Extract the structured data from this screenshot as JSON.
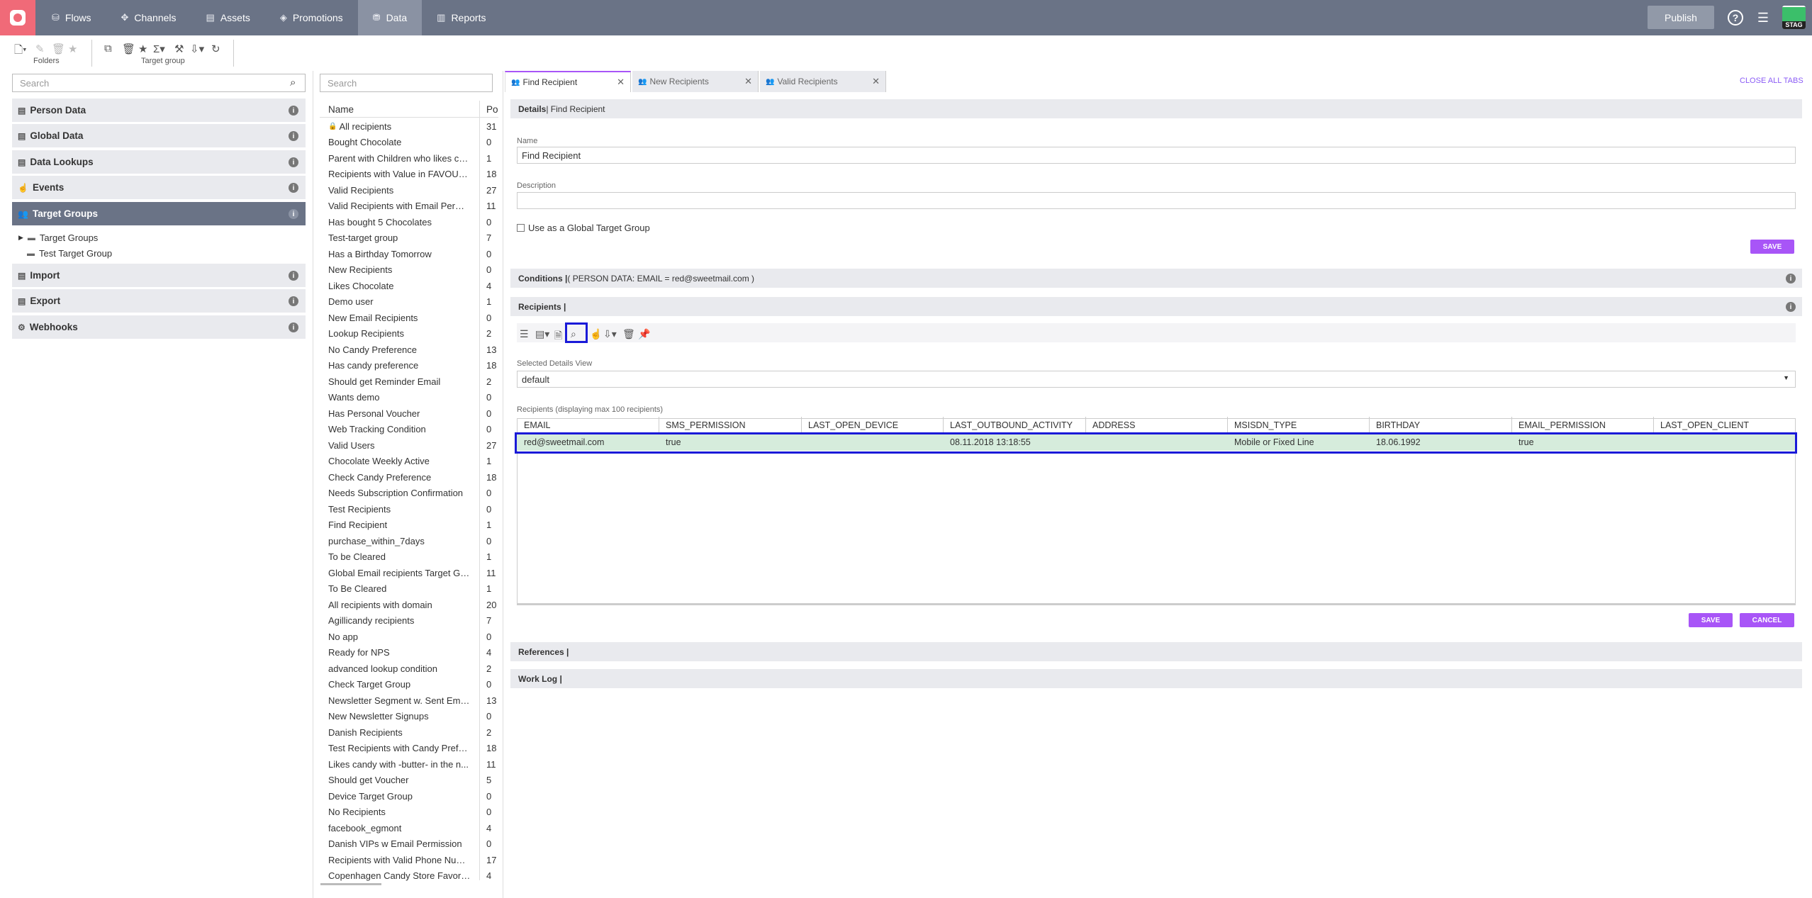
{
  "topnav": {
    "items": [
      {
        "label": "Flows",
        "icon": "flows-icon"
      },
      {
        "label": "Channels",
        "icon": "channels-icon"
      },
      {
        "label": "Assets",
        "icon": "assets-icon"
      },
      {
        "label": "Promotions",
        "icon": "promotions-icon"
      },
      {
        "label": "Data",
        "icon": "data-icon",
        "active": true
      },
      {
        "label": "Reports",
        "icon": "reports-icon"
      }
    ],
    "publish": "Publish",
    "env_badge": "STAG"
  },
  "toolbar": {
    "folders_label": "Folders",
    "target_group_label": "Target group"
  },
  "left_search": {
    "placeholder": "Search"
  },
  "left_panel": {
    "items": [
      {
        "label": "Person Data"
      },
      {
        "label": "Global Data"
      },
      {
        "label": "Data Lookups"
      },
      {
        "label": "Events"
      },
      {
        "label": "Target Groups",
        "active": true
      },
      {
        "label": "Import"
      },
      {
        "label": "Export"
      },
      {
        "label": "Webhooks"
      }
    ],
    "tree": [
      {
        "label": "Target Groups"
      },
      {
        "label": "Test Target Group"
      }
    ]
  },
  "mid_search": {
    "placeholder": "Search"
  },
  "mid_list": {
    "col_name": "Name",
    "col_po": "Po",
    "rows": [
      {
        "name": "All recipients",
        "po": "31"
      },
      {
        "name": "Bought Chocolate",
        "po": "0"
      },
      {
        "name": "Parent with Children who likes ch...",
        "po": "1"
      },
      {
        "name": "Recipients with Value in FAVOUR...",
        "po": "18"
      },
      {
        "name": "Valid Recipients",
        "po": "27"
      },
      {
        "name": "Valid Recipients with Email Permi...",
        "po": "11"
      },
      {
        "name": "Has bought 5 Chocolates",
        "po": "0"
      },
      {
        "name": "Test-target group",
        "po": "7"
      },
      {
        "name": "Has a Birthday Tomorrow",
        "po": "0"
      },
      {
        "name": "New Recipients",
        "po": "0"
      },
      {
        "name": "Likes Chocolate",
        "po": "4"
      },
      {
        "name": "Demo user",
        "po": "1"
      },
      {
        "name": "New Email Recipients",
        "po": "0"
      },
      {
        "name": "Lookup Recipients",
        "po": "2"
      },
      {
        "name": "No Candy Preference",
        "po": "13"
      },
      {
        "name": "Has candy preference",
        "po": "18"
      },
      {
        "name": "Should get Reminder Email",
        "po": "2"
      },
      {
        "name": "Wants demo",
        "po": "0"
      },
      {
        "name": "Has Personal Voucher",
        "po": "0"
      },
      {
        "name": "Web Tracking Condition",
        "po": "0"
      },
      {
        "name": "Valid Users",
        "po": "27"
      },
      {
        "name": "Chocolate Weekly Active",
        "po": "1"
      },
      {
        "name": "Check Candy Preference",
        "po": "18"
      },
      {
        "name": "Needs Subscription Confirmation",
        "po": "0"
      },
      {
        "name": "Test Recipients",
        "po": "0"
      },
      {
        "name": "Find Recipient",
        "po": "1"
      },
      {
        "name": "purchase_within_7days",
        "po": "0"
      },
      {
        "name": "To be Cleared",
        "po": "1"
      },
      {
        "name": "Global Email recipients Target Gro...",
        "po": "11"
      },
      {
        "name": "To Be Cleared",
        "po": "1"
      },
      {
        "name": "All recipients with domain",
        "po": "20"
      },
      {
        "name": "Agillicandy recipients",
        "po": "7"
      },
      {
        "name": "No app",
        "po": "0"
      },
      {
        "name": "Ready for NPS",
        "po": "4"
      },
      {
        "name": "advanced lookup condition",
        "po": "2"
      },
      {
        "name": "Check Target Group",
        "po": "0"
      },
      {
        "name": "Newsletter Segment w. Sent Ema...",
        "po": "13"
      },
      {
        "name": "New Newsletter Signups",
        "po": "0"
      },
      {
        "name": "Danish Recipients",
        "po": "2"
      },
      {
        "name": "Test Recipients with Candy Prefer...",
        "po": "18"
      },
      {
        "name": "Likes candy with -butter- in the n...",
        "po": "11"
      },
      {
        "name": "Should get Voucher",
        "po": "5"
      },
      {
        "name": "Device Target Group",
        "po": "0"
      },
      {
        "name": "No Recipients",
        "po": "0"
      },
      {
        "name": "facebook_egmont",
        "po": "4"
      },
      {
        "name": "Danish VIPs w Email Permission",
        "po": "0"
      },
      {
        "name": "Recipients with Valid Phone Num...",
        "po": "17"
      },
      {
        "name": "Copenhagen Candy Store Favorit...",
        "po": "4"
      }
    ]
  },
  "tabs": [
    {
      "label": "Find Recipient",
      "active": true
    },
    {
      "label": "New Recipients"
    },
    {
      "label": "Valid Recipients"
    }
  ],
  "close_all": "CLOSE ALL TABS",
  "details": {
    "header_bold": "Details",
    "header_rest": " | Find Recipient",
    "name_label": "Name",
    "name_value": "Find Recipient",
    "description_label": "Description",
    "description_value": "",
    "global_checkbox": "Use as a Global Target Group",
    "save": "SAVE"
  },
  "conditions": {
    "header_bold": "Conditions |",
    "header_rest": " ( PERSON DATA: EMAIL = red@sweetmail.com )"
  },
  "recipients": {
    "header_bold": "Recipients |",
    "view_label": "Selected Details View",
    "view_value": "default",
    "table_caption": "Recipients (displaying max 100 recipients)",
    "columns": [
      "EMAIL",
      "SMS_PERMISSION",
      "LAST_OPEN_DEVICE",
      "LAST_OUTBOUND_ACTIVITY",
      "ADDRESS",
      "MSISDN_TYPE",
      "BIRTHDAY",
      "EMAIL_PERMISSION",
      "LAST_OPEN_CLIENT"
    ],
    "rows": [
      [
        "red@sweetmail.com",
        "true",
        "",
        "08.11.2018 13:18:55",
        "",
        "Mobile or Fixed Line",
        "18.06.1992",
        "true",
        ""
      ]
    ],
    "save": "SAVE",
    "cancel": "CANCEL"
  },
  "references": {
    "header_bold": "References |"
  },
  "worklog": {
    "header_bold": "Work Log |"
  },
  "colors": {
    "accent": "#a855f7",
    "topbar": "#6a7386",
    "highlight": "#1a1ad8",
    "selected_row": "#d6ecdc"
  }
}
